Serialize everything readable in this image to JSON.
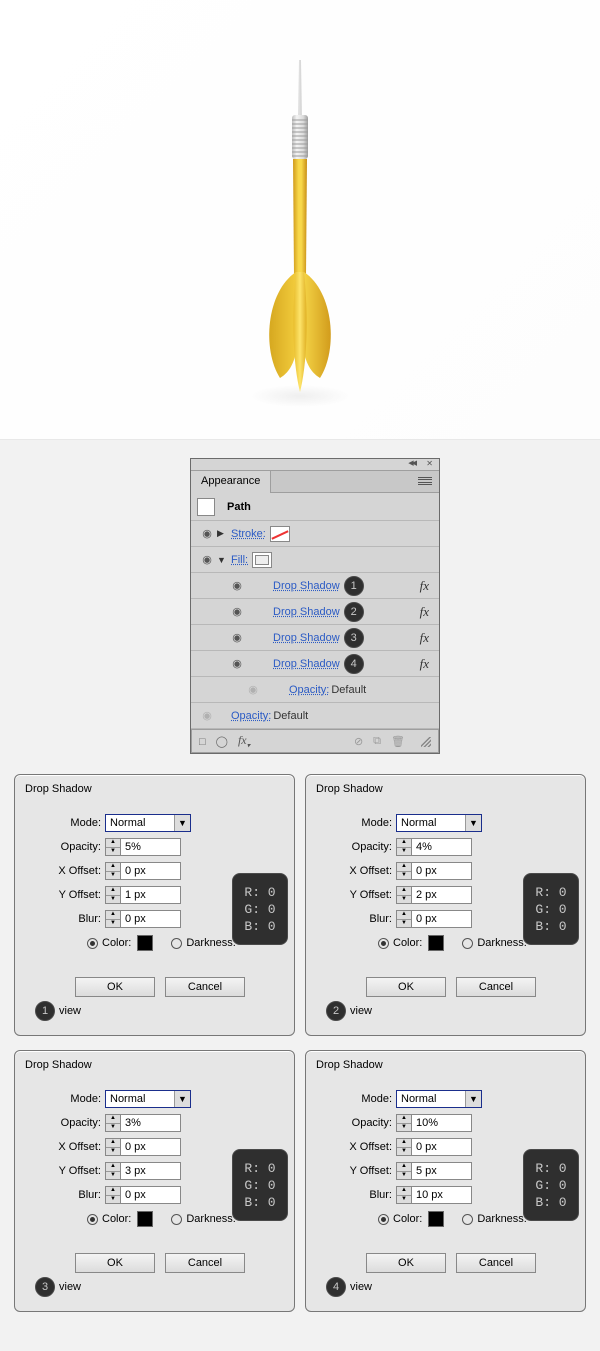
{
  "appearance_panel": {
    "tab_label": "Appearance",
    "path_label": "Path",
    "stroke_label": "Stroke:",
    "fill_label": "Fill:",
    "opacity_label": "Opacity:",
    "default_label": "Default",
    "effects": [
      {
        "label": "Drop Shadow",
        "num": "1"
      },
      {
        "label": "Drop Shadow",
        "num": "2"
      },
      {
        "label": "Drop Shadow",
        "num": "3"
      },
      {
        "label": "Drop Shadow",
        "num": "4"
      }
    ],
    "fx_abbrev": "fx"
  },
  "dialog_labels": {
    "title": "Drop Shadow",
    "mode": "Mode:",
    "opacity": "Opacity:",
    "xoffset": "X Offset:",
    "yoffset": "Y Offset:",
    "blur": "Blur:",
    "color": "Color:",
    "darkness": "Darkness:",
    "preview": "view",
    "ok": "OK",
    "cancel": "Cancel"
  },
  "rgb": {
    "r": "R: 0",
    "g": "G: 0",
    "b": "B: 0"
  },
  "dialogs": [
    {
      "num": "1",
      "mode": "Normal",
      "opacity": "5%",
      "xoffset": "0 px",
      "yoffset": "1 px",
      "blur": "0 px"
    },
    {
      "num": "2",
      "mode": "Normal",
      "opacity": "4%",
      "xoffset": "0 px",
      "yoffset": "2 px",
      "blur": "0 px"
    },
    {
      "num": "3",
      "mode": "Normal",
      "opacity": "3%",
      "xoffset": "0 px",
      "yoffset": "3 px",
      "blur": "0 px"
    },
    {
      "num": "4",
      "mode": "Normal",
      "opacity": "10%",
      "xoffset": "0 px",
      "yoffset": "5 px",
      "blur": "10 px"
    }
  ]
}
